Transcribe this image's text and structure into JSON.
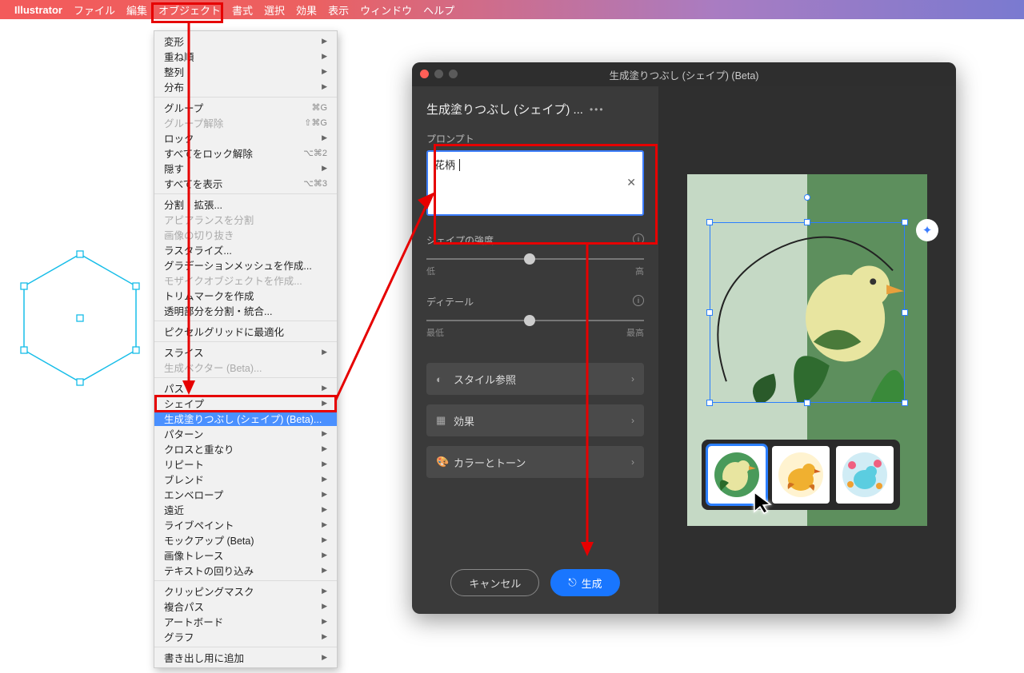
{
  "menubar": {
    "app": "Illustrator",
    "items": [
      "ファイル",
      "編集",
      "オブジェクト",
      "書式",
      "選択",
      "効果",
      "表示",
      "ウィンドウ",
      "ヘルプ"
    ]
  },
  "dropdown": {
    "sections": [
      [
        {
          "label": "変形",
          "sub": true
        },
        {
          "label": "重ね順",
          "sub": true
        },
        {
          "label": "整列",
          "sub": true
        },
        {
          "label": "分布",
          "sub": true
        }
      ],
      [
        {
          "label": "グループ",
          "shortcut": "⌘G"
        },
        {
          "label": "グループ解除",
          "shortcut": "⇧⌘G",
          "disabled": true
        },
        {
          "label": "ロック",
          "sub": true
        },
        {
          "label": "すべてをロック解除",
          "shortcut": "⌥⌘2"
        },
        {
          "label": "隠す",
          "sub": true
        },
        {
          "label": "すべてを表示",
          "shortcut": "⌥⌘3"
        }
      ],
      [
        {
          "label": "分割・拡張..."
        },
        {
          "label": "アピアランスを分割",
          "disabled": true
        },
        {
          "label": "画像の切り抜き",
          "disabled": true
        },
        {
          "label": "ラスタライズ..."
        },
        {
          "label": "グラデーションメッシュを作成..."
        },
        {
          "label": "モザイクオブジェクトを作成...",
          "disabled": true
        },
        {
          "label": "トリムマークを作成"
        },
        {
          "label": "透明部分を分割・統合..."
        }
      ],
      [
        {
          "label": "ピクセルグリッドに最適化"
        }
      ],
      [
        {
          "label": "スライス",
          "sub": true
        },
        {
          "label": "生成ベクター (Beta)...",
          "disabled": true
        }
      ],
      [
        {
          "label": "パス",
          "sub": true
        },
        {
          "label": "シェイプ",
          "sub": true
        },
        {
          "label": "生成塗りつぶし (シェイプ) (Beta)...",
          "highlight": true
        },
        {
          "label": "パターン",
          "sub": true
        },
        {
          "label": "クロスと重なり",
          "sub": true
        },
        {
          "label": "リピート",
          "sub": true
        },
        {
          "label": "ブレンド",
          "sub": true
        },
        {
          "label": "エンベロープ",
          "sub": true
        },
        {
          "label": "遠近",
          "sub": true
        },
        {
          "label": "ライブペイント",
          "sub": true
        },
        {
          "label": "モックアップ (Beta)",
          "sub": true
        },
        {
          "label": "画像トレース",
          "sub": true
        },
        {
          "label": "テキストの回り込み",
          "sub": true
        }
      ],
      [
        {
          "label": "クリッピングマスク",
          "sub": true
        },
        {
          "label": "複合パス",
          "sub": true
        },
        {
          "label": "アートボード",
          "sub": true
        },
        {
          "label": "グラフ",
          "sub": true
        }
      ],
      [
        {
          "label": "書き出し用に追加",
          "sub": true
        }
      ]
    ]
  },
  "dialog": {
    "title": "生成塗りつぶし (シェイプ) (Beta)",
    "panel_title": "生成塗りつぶし (シェイプ) ...",
    "prompt_label": "プロンプト",
    "prompt_value": "花柄",
    "slider1": {
      "label": "シェイプの強度",
      "lo": "低",
      "hi": "高",
      "pos": 45
    },
    "slider2": {
      "label": "ディテール",
      "lo": "最低",
      "hi": "最高",
      "pos": 45
    },
    "opts": [
      {
        "icon": "◐",
        "label": "スタイル参照"
      },
      {
        "icon": "▦",
        "label": "効果"
      },
      {
        "icon": "🎨",
        "label": "カラーとトーン"
      }
    ],
    "cancel": "キャンセル",
    "generate": "生成"
  }
}
